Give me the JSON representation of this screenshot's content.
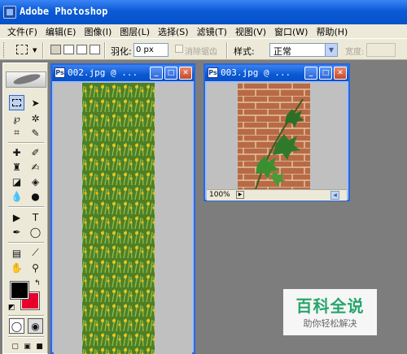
{
  "app": {
    "title": "Adobe Photoshop"
  },
  "menu": [
    "文件(F)",
    "编辑(E)",
    "图像(I)",
    "图层(L)",
    "选择(S)",
    "滤镜(T)",
    "视图(V)",
    "窗口(W)",
    "帮助(H)"
  ],
  "options": {
    "feather_label": "羽化:",
    "feather_value": "0 px",
    "antialias_label": "消除锯齿",
    "style_label": "样式:",
    "style_value": "正常",
    "width_label": "宽度:"
  },
  "documents": [
    {
      "name": "002.jpg @ ...",
      "image": "flower field with yellow blossoms"
    },
    {
      "name": "003.jpg @ ...",
      "image": "ivy leaves on brick wall",
      "zoom": "100%"
    }
  ],
  "colors": {
    "foreground": "#000000",
    "background": "#e8002a",
    "titlebar": "#0a5bd6"
  },
  "watermark": {
    "title": "百科全说",
    "subtitle": "助你轻松解决"
  }
}
